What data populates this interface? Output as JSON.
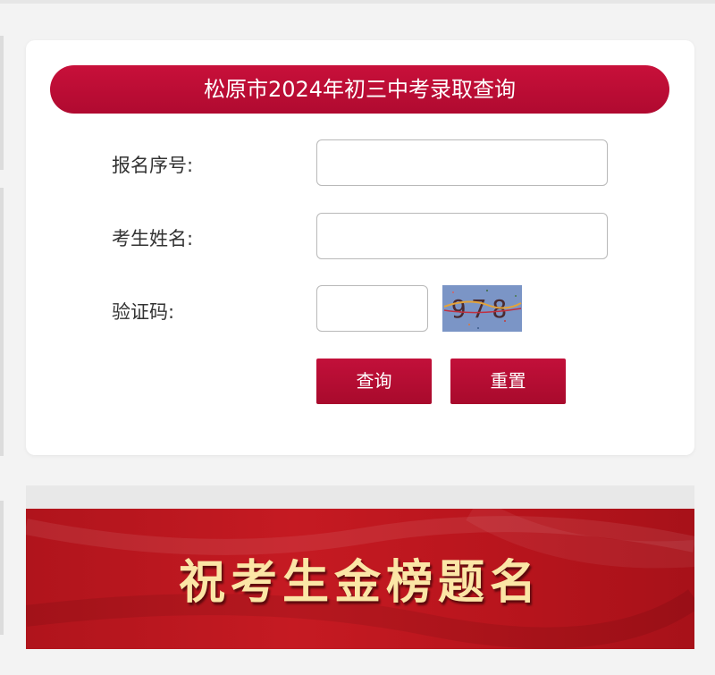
{
  "form": {
    "title": "松原市2024年初三中考录取查询",
    "fields": [
      {
        "label": "报名序号:",
        "value": "",
        "placeholder": ""
      },
      {
        "label": "考生姓名:",
        "value": "",
        "placeholder": ""
      },
      {
        "label": "验证码:",
        "value": "",
        "placeholder": ""
      }
    ],
    "captcha_text": "978",
    "buttons": {
      "query": "查询",
      "reset": "重置"
    }
  },
  "banner": {
    "text": "祝考生金榜题名"
  },
  "colors": {
    "accent": "#b80c33",
    "banner_red": "#b7151d",
    "banner_text": "#fbe6a6",
    "captcha_bg": "#7b95c6"
  }
}
